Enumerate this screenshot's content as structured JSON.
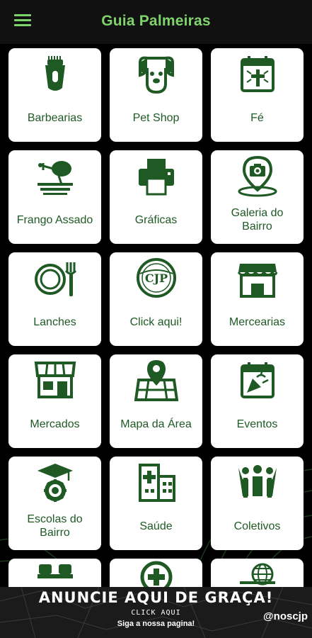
{
  "app": {
    "title": "Guia Palmeiras",
    "menu_icon": "hamburger-menu-icon",
    "accent_color": "#7fd36b",
    "tile_icon_color": "#1f5a25"
  },
  "tiles": [
    {
      "label": "Barbearias",
      "icon": "hair-clipper-icon"
    },
    {
      "label": "Pet Shop",
      "icon": "dog-icon"
    },
    {
      "label": "Fé",
      "icon": "calendar-cross-icon"
    },
    {
      "label": "Frango Assado",
      "icon": "roast-chicken-icon"
    },
    {
      "label": "Gráficas",
      "icon": "printer-icon"
    },
    {
      "label": "Galeria do\nBairro",
      "icon": "camera-pin-icon"
    },
    {
      "label": "Lanches",
      "icon": "plate-fork-icon"
    },
    {
      "label": "Click aqui!",
      "icon": "cjp-logo-icon"
    },
    {
      "label": "Mercearias",
      "icon": "storefront-icon"
    },
    {
      "label": "Mercados",
      "icon": "market-icon"
    },
    {
      "label": "Mapa da Área",
      "icon": "map-pin-icon"
    },
    {
      "label": "Eventos",
      "icon": "calendar-party-icon"
    },
    {
      "label": "Escolas do\nBairro",
      "icon": "graduation-gear-icon"
    },
    {
      "label": "Saúde",
      "icon": "hospital-icon"
    },
    {
      "label": "Coletivos",
      "icon": "group-people-icon"
    },
    {
      "label": "",
      "icon": "partial-icon"
    },
    {
      "label": "",
      "icon": "medical-plus-icon"
    },
    {
      "label": "",
      "icon": "globe-icon"
    }
  ],
  "cjp_logo_text": "CJP",
  "banner": {
    "headline": "ANUNCIE AQUI  DE GRAÇA!",
    "click": "CLICK AQUI",
    "subtitle": "Siga a nossa pagina!",
    "handle": "@noscjp"
  }
}
